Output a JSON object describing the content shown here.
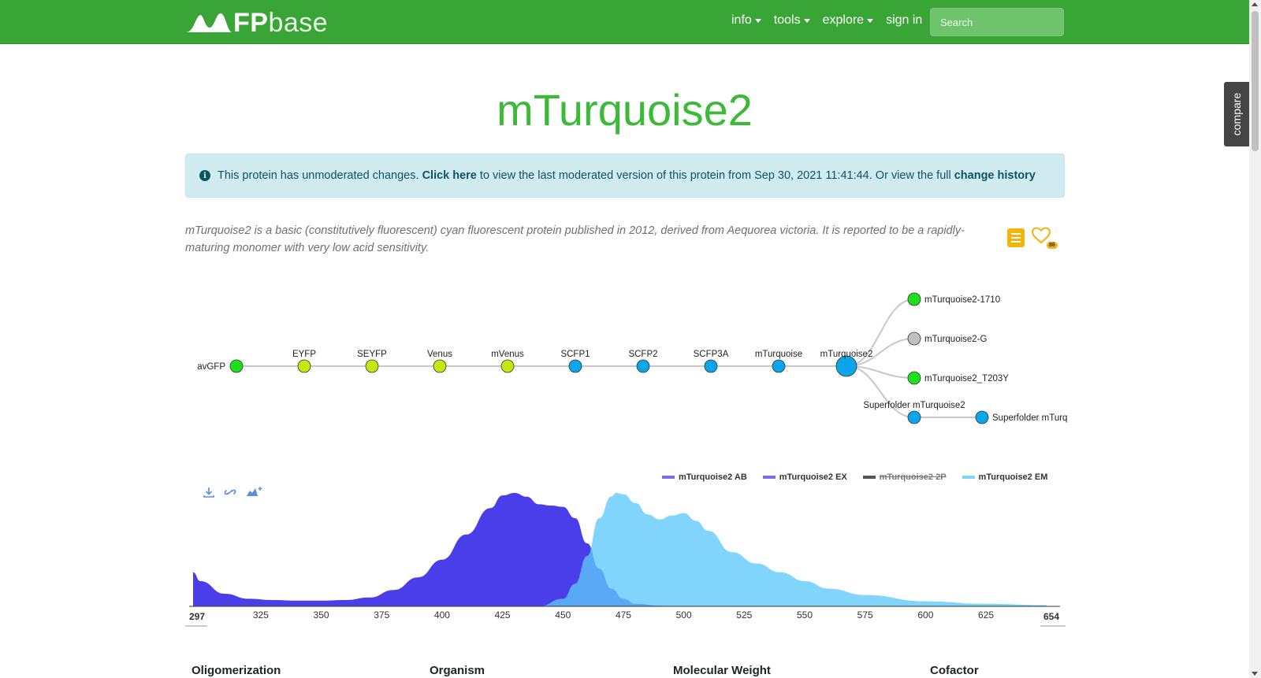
{
  "nav": {
    "logo_fp": "FP",
    "logo_base": "base",
    "links": [
      "info",
      "tools",
      "explore",
      "sign in"
    ],
    "search_placeholder": "Search"
  },
  "compare_label": "compare",
  "title": "mTurquoise2",
  "alert": {
    "text1": "This protein has unmoderated changes. ",
    "link1": "Click here",
    "text2": " to view the last moderated version of this protein from Sep 30, 2021 11:41:44. Or view the full ",
    "link2": "change history"
  },
  "description": "mTurquoise2 is a basic (constitutively fluorescent) cyan fluorescent protein published in 2012, derived from Aequorea victoria. It is reported to be a rapidly-maturing monomer with very low acid sensitivity.",
  "favorites_count": "86",
  "lineage": {
    "main": [
      {
        "name": "avGFP",
        "color": "#1de01d"
      },
      {
        "name": "EYFP",
        "color": "#c6e80e"
      },
      {
        "name": "SEYFP",
        "color": "#c6e80e"
      },
      {
        "name": "Venus",
        "color": "#c6e80e"
      },
      {
        "name": "mVenus",
        "color": "#c6e80e"
      },
      {
        "name": "SCFP1",
        "color": "#0aa5ea"
      },
      {
        "name": "SCFP2",
        "color": "#0aa5ea"
      },
      {
        "name": "SCFP3A",
        "color": "#0aa5ea"
      },
      {
        "name": "mTurquoise",
        "color": "#0aa5ea"
      },
      {
        "name": "mTurquoise2",
        "color": "#0aa5ea"
      }
    ],
    "children": [
      {
        "name": "mTurquoise2-1710",
        "color": "#1de01d"
      },
      {
        "name": "mTurquoise2-G",
        "color": "#c0c0c0"
      },
      {
        "name": "mTurquoise2_T203Y",
        "color": "#1de01d"
      },
      {
        "name": "Superfolder mTurquoise2",
        "color": "#0aa5ea"
      }
    ],
    "grandchild": {
      "name": "Superfolder mTurq",
      "color": "#0aa5ea"
    }
  },
  "spectra": {
    "legend": [
      {
        "name": "mTurquoise2 AB",
        "color": "#7b70e8",
        "hidden": false
      },
      {
        "name": "mTurquoise2 EX",
        "color": "#7b70e8",
        "hidden": false
      },
      {
        "name": "mTurquoise2 2P",
        "color": "#555555",
        "hidden": true
      },
      {
        "name": "mTurquoise2 EM",
        "color": "#7fd3fb",
        "hidden": false
      }
    ],
    "x_min": 297,
    "x_max": 654,
    "x_ticks": [
      325,
      350,
      375,
      400,
      425,
      450,
      475,
      500,
      525,
      550,
      575,
      600,
      625
    ],
    "ex": {
      "x": [
        297,
        300,
        310,
        320,
        330,
        340,
        350,
        360,
        370,
        380,
        390,
        400,
        410,
        420,
        425,
        430,
        435,
        440,
        445,
        450,
        455,
        460,
        465,
        470,
        475,
        480,
        490,
        500
      ],
      "y": [
        0.27,
        0.2,
        0.1,
        0.06,
        0.05,
        0.045,
        0.045,
        0.05,
        0.07,
        0.13,
        0.23,
        0.37,
        0.57,
        0.78,
        0.88,
        0.9,
        0.87,
        0.81,
        0.8,
        0.79,
        0.7,
        0.5,
        0.3,
        0.14,
        0.06,
        0.02,
        0.005,
        0
      ]
    },
    "em": {
      "x": [
        440,
        450,
        455,
        460,
        465,
        470,
        472,
        475,
        480,
        485,
        490,
        495,
        500,
        505,
        510,
        520,
        530,
        540,
        550,
        560,
        575,
        600,
        625,
        650
      ],
      "y": [
        0,
        0.06,
        0.18,
        0.4,
        0.7,
        0.87,
        0.9,
        0.89,
        0.82,
        0.73,
        0.69,
        0.72,
        0.74,
        0.68,
        0.6,
        0.43,
        0.34,
        0.27,
        0.2,
        0.14,
        0.09,
        0.04,
        0.02,
        0.01
      ]
    }
  },
  "properties": [
    "Oligomerization",
    "Organism",
    "Molecular Weight",
    "Cofactor"
  ]
}
